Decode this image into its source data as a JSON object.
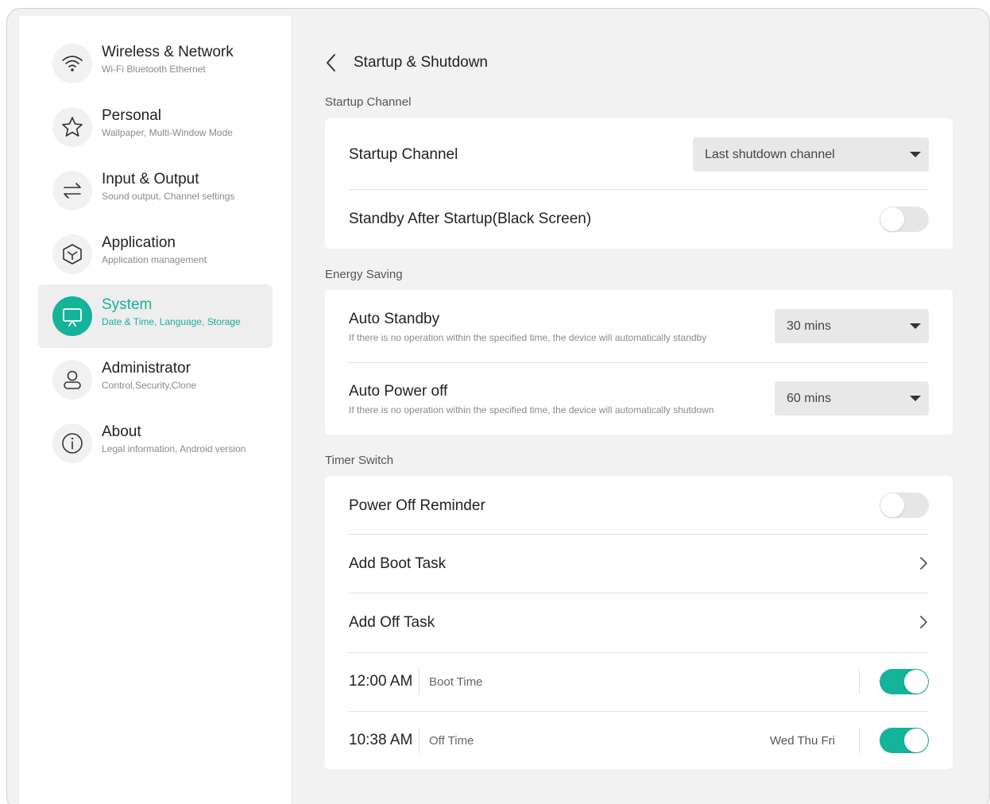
{
  "colors": {
    "accent": "#14b39a",
    "background": "#f2f2f2",
    "card": "#ffffff"
  },
  "sidebar": {
    "items": [
      {
        "title": "Wireless & Network",
        "subtitle": "Wi-Fi Bluetooth Ethernet",
        "icon": "wifi-icon",
        "active": false
      },
      {
        "title": "Personal",
        "subtitle": "Wallpaper, Multi-Window Mode",
        "icon": "star-icon",
        "active": false
      },
      {
        "title": "Input & Output",
        "subtitle": "Sound output, Channel settings",
        "icon": "swap-arrows-icon",
        "active": false
      },
      {
        "title": "Application",
        "subtitle": "Application management",
        "icon": "cube-icon",
        "active": false
      },
      {
        "title": "System",
        "subtitle": "Date & Time, Language, Storage",
        "icon": "monitor-icon",
        "active": true
      },
      {
        "title": "Administrator",
        "subtitle": "Control,Security,Clone",
        "icon": "user-icon",
        "active": false
      },
      {
        "title": "About",
        "subtitle": "Legal information, Android version",
        "icon": "info-icon",
        "active": false
      }
    ]
  },
  "header": {
    "title": "Startup & Shutdown"
  },
  "sections": {
    "startup": {
      "label": "Startup Channel",
      "channel_title": "Startup Channel",
      "channel_value": "Last shutdown channel",
      "standby_title": "Standby After Startup(Black Screen)",
      "standby_on": false
    },
    "energy": {
      "label": "Energy Saving",
      "auto_standby_title": "Auto Standby",
      "auto_standby_desc": "If there is no operation within the specified time, the device will automatically standby",
      "auto_standby_value": "30 mins",
      "auto_poweroff_title": "Auto Power off",
      "auto_poweroff_desc": "If there is no operation within the specified time, the device will automatically shutdown",
      "auto_poweroff_value": "60 mins"
    },
    "timer": {
      "label": "Timer Switch",
      "reminder_title": "Power Off Reminder",
      "reminder_on": false,
      "add_boot": "Add Boot Task",
      "add_off": "Add Off Task",
      "tasks": [
        {
          "time": "12:00 AM",
          "label": "Boot Time",
          "days": "",
          "on": true
        },
        {
          "time": "10:38 AM",
          "label": "Off Time",
          "days": "Wed Thu Fri",
          "on": true
        }
      ]
    }
  }
}
